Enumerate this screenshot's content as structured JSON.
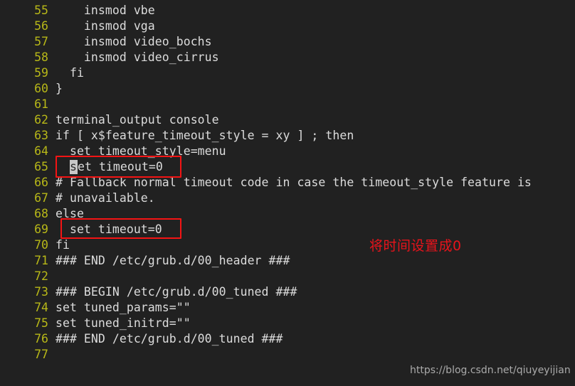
{
  "editor": {
    "background_color": "#212121",
    "line_number_color": "#b8b818",
    "code_text_color": "#dcdcdc",
    "first_line_number": 55,
    "lines": [
      {
        "number": "55",
        "text": "    insmod vbe"
      },
      {
        "number": "56",
        "text": "    insmod vga"
      },
      {
        "number": "57",
        "text": "    insmod video_bochs"
      },
      {
        "number": "58",
        "text": "    insmod video_cirrus"
      },
      {
        "number": "59",
        "text": "  fi"
      },
      {
        "number": "60",
        "text": "}"
      },
      {
        "number": "61",
        "text": ""
      },
      {
        "number": "62",
        "text": "terminal_output console"
      },
      {
        "number": "63",
        "text": "if [ x$feature_timeout_style = xy ] ; then"
      },
      {
        "number": "64",
        "text": "  set timeout_style=menu"
      },
      {
        "number": "65",
        "text": "  set timeout=0"
      },
      {
        "number": "66",
        "text": "# Fallback normal timeout code in case the timeout_style feature is"
      },
      {
        "number": "67",
        "text": "# unavailable."
      },
      {
        "number": "68",
        "text": "else"
      },
      {
        "number": "69",
        "text": "  set timeout=0"
      },
      {
        "number": "70",
        "text": "fi"
      },
      {
        "number": "71",
        "text": "### END /etc/grub.d/00_header ###"
      },
      {
        "number": "72",
        "text": ""
      },
      {
        "number": "73",
        "text": "### BEGIN /etc/grub.d/00_tuned ###"
      },
      {
        "number": "74",
        "text": "set tuned_params=\"\""
      },
      {
        "number": "75",
        "text": "set tuned_initrd=\"\""
      },
      {
        "number": "76",
        "text": "### END /etc/grub.d/00_tuned ###"
      },
      {
        "number": "77",
        "text": ""
      }
    ]
  },
  "cursor": {
    "line_number": "65",
    "character": "s",
    "block_color": "#c8c8c8"
  },
  "highlights": [
    {
      "id": "highlight-line-65",
      "target_line": "65",
      "label": "set timeout=0",
      "color": "#f41414"
    },
    {
      "id": "highlight-line-69",
      "target_line": "69",
      "label": "set timeout=0",
      "color": "#f41414"
    }
  ],
  "annotation": {
    "text": "将时间设置成0",
    "color": "#e8131b"
  },
  "watermark": {
    "text": "https://blog.csdn.net/qiuyeyijian",
    "color": "#b6b6b6"
  }
}
